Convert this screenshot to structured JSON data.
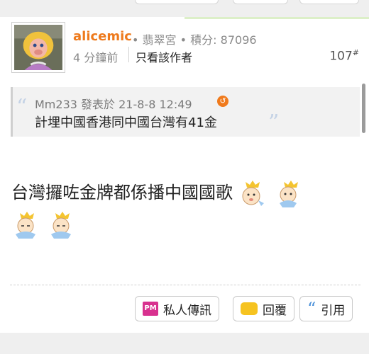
{
  "post": {
    "username": "alicemic",
    "group": "翡翠宮",
    "points_label": "積分:",
    "points": "87096",
    "time": "4 分鐘前",
    "only_author": "只看該作者",
    "floor_number": "107",
    "floor_mark": "#"
  },
  "quote": {
    "author_line": "Mm233 發表於 21-8-8 12:49",
    "text": "計埋中國香港同中國台灣有41金"
  },
  "content": {
    "text": "台灣攞咗金牌都係播中國國歌",
    "emoji_icons": [
      "baby-crown-icon",
      "baby-crown-icon",
      "baby-crown-icon",
      "baby-crown-icon"
    ]
  },
  "actions": {
    "pm_icon_text": "PM",
    "pm_label": "私人傳訊",
    "reply_label": "回覆",
    "quote_label": "引用"
  },
  "colors": {
    "username": "#ee7a1c",
    "pm_icon": "#d8318f",
    "reply_icon": "#f6c320",
    "quote_icon": "#4a90d9"
  }
}
